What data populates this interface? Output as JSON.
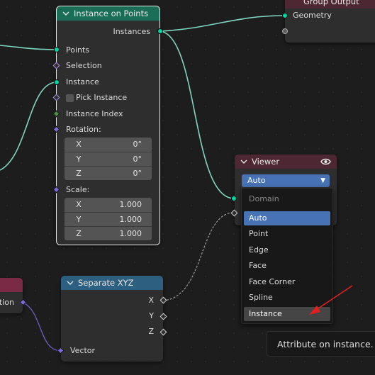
{
  "group_output": {
    "title": "Group Output",
    "inputs": [
      "Geometry",
      ""
    ]
  },
  "instance_on_points": {
    "title": "Instance on Points",
    "output": "Instances",
    "inputs": {
      "points": "Points",
      "selection": "Selection",
      "instance": "Instance",
      "pick_instance": "Pick Instance",
      "instance_index": "Instance Index",
      "rotation": "Rotation:",
      "scale": "Scale:"
    },
    "rotation": [
      {
        "axis": "X",
        "value": "0°"
      },
      {
        "axis": "Y",
        "value": "0°"
      },
      {
        "axis": "Z",
        "value": "0°"
      }
    ],
    "scale": [
      {
        "axis": "X",
        "value": "1.000"
      },
      {
        "axis": "Y",
        "value": "1.000"
      },
      {
        "axis": "Z",
        "value": "1.000"
      }
    ]
  },
  "viewer": {
    "title": "Viewer",
    "domain_value": "Auto",
    "icon": "eye-icon"
  },
  "domain_menu": {
    "title": "Domain",
    "items": [
      "Auto",
      "Point",
      "Edge",
      "Face",
      "Face Corner",
      "Spline",
      "Instance"
    ],
    "active": "Auto",
    "hovered": "Instance"
  },
  "separate_xyz": {
    "title": "Separate XYZ",
    "outputs": [
      "X",
      "Y",
      "Z"
    ],
    "input": "Vector"
  },
  "left_node": {
    "partial_label": "tion"
  },
  "tooltip": "Attribute on instance.",
  "colors": {
    "geometry_socket": "#00d6a3",
    "vector_socket": "#7d6ad8",
    "int_socket": "#4f8d47",
    "geometry_header": "#1a6e57",
    "converter_header": "#2d5f80",
    "output_header": "#4d2731",
    "accent": "#4772b3",
    "annotation_arrow": "#e02020"
  }
}
